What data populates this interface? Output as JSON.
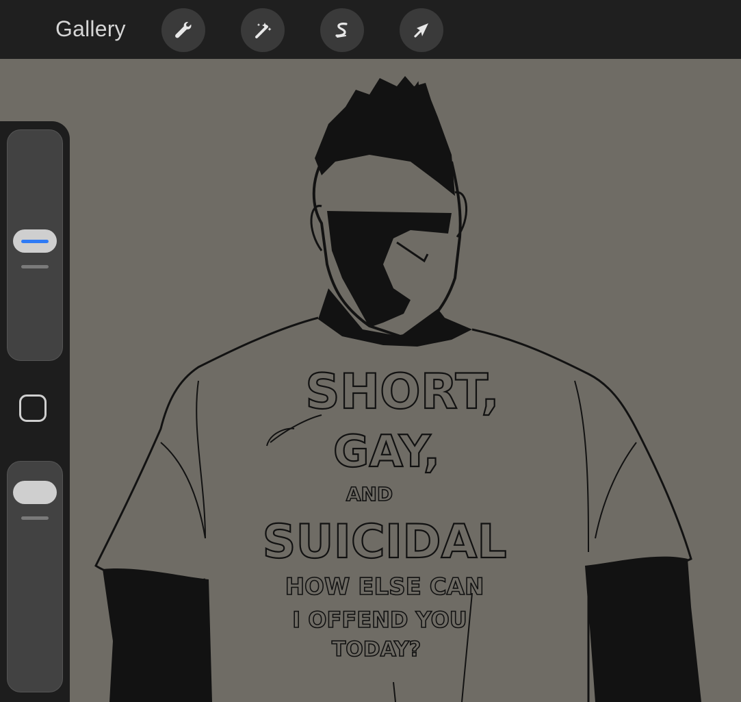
{
  "app": {
    "gallery_label": "Gallery"
  },
  "toolbar": {
    "tools": [
      {
        "name": "wrench-icon"
      },
      {
        "name": "magic-wand-icon"
      },
      {
        "name": "selection-s-icon"
      },
      {
        "name": "arrow-cursor-icon"
      }
    ]
  },
  "sidebar": {
    "brush_size_level": 0.55,
    "opacity_level": 0.9,
    "accent_color": "#2f7bf5"
  },
  "artwork": {
    "shirt_lines": [
      "SHORT,",
      "GAY,",
      "AND",
      "SUICIDAL",
      "HOW ELSE CAN",
      "I OFFEND YOU",
      "TODAY?"
    ],
    "canvas_color": "#6f6c65",
    "ink_color": "#111111"
  }
}
